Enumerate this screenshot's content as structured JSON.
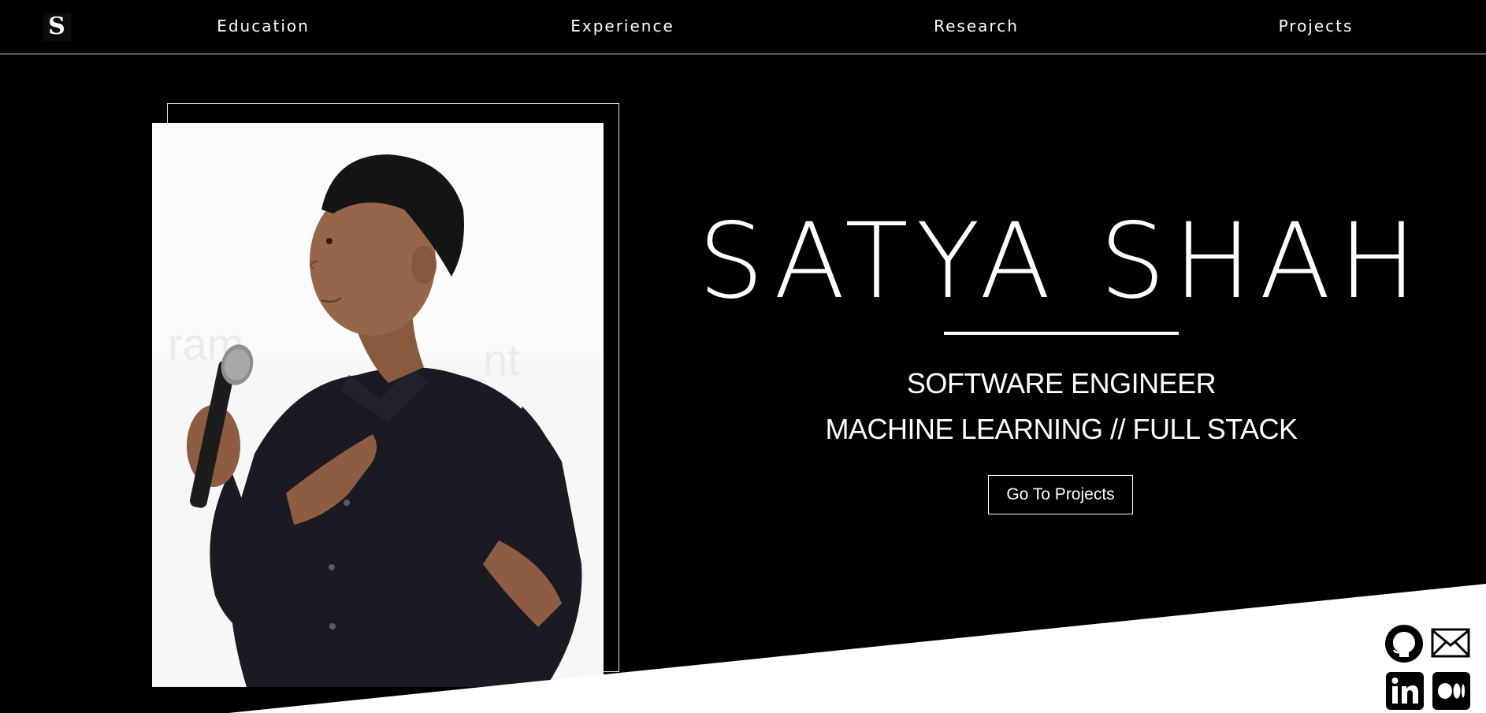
{
  "nav": {
    "logo_letter": "S",
    "links": [
      {
        "label": "Education"
      },
      {
        "label": "Experience"
      },
      {
        "label": "Research"
      },
      {
        "label": "Projects"
      }
    ]
  },
  "hero": {
    "name": "SATYA SHAH",
    "role": "SOFTWARE ENGINEER",
    "focus": "MACHINE LEARNING // FULL STACK",
    "cta_label": "Go To Projects"
  },
  "social": [
    {
      "icon": "github-icon"
    },
    {
      "icon": "mail-icon"
    },
    {
      "icon": "linkedin-icon"
    },
    {
      "icon": "medium-icon"
    }
  ],
  "colors": {
    "background": "#000000",
    "foreground": "#ffffff"
  }
}
